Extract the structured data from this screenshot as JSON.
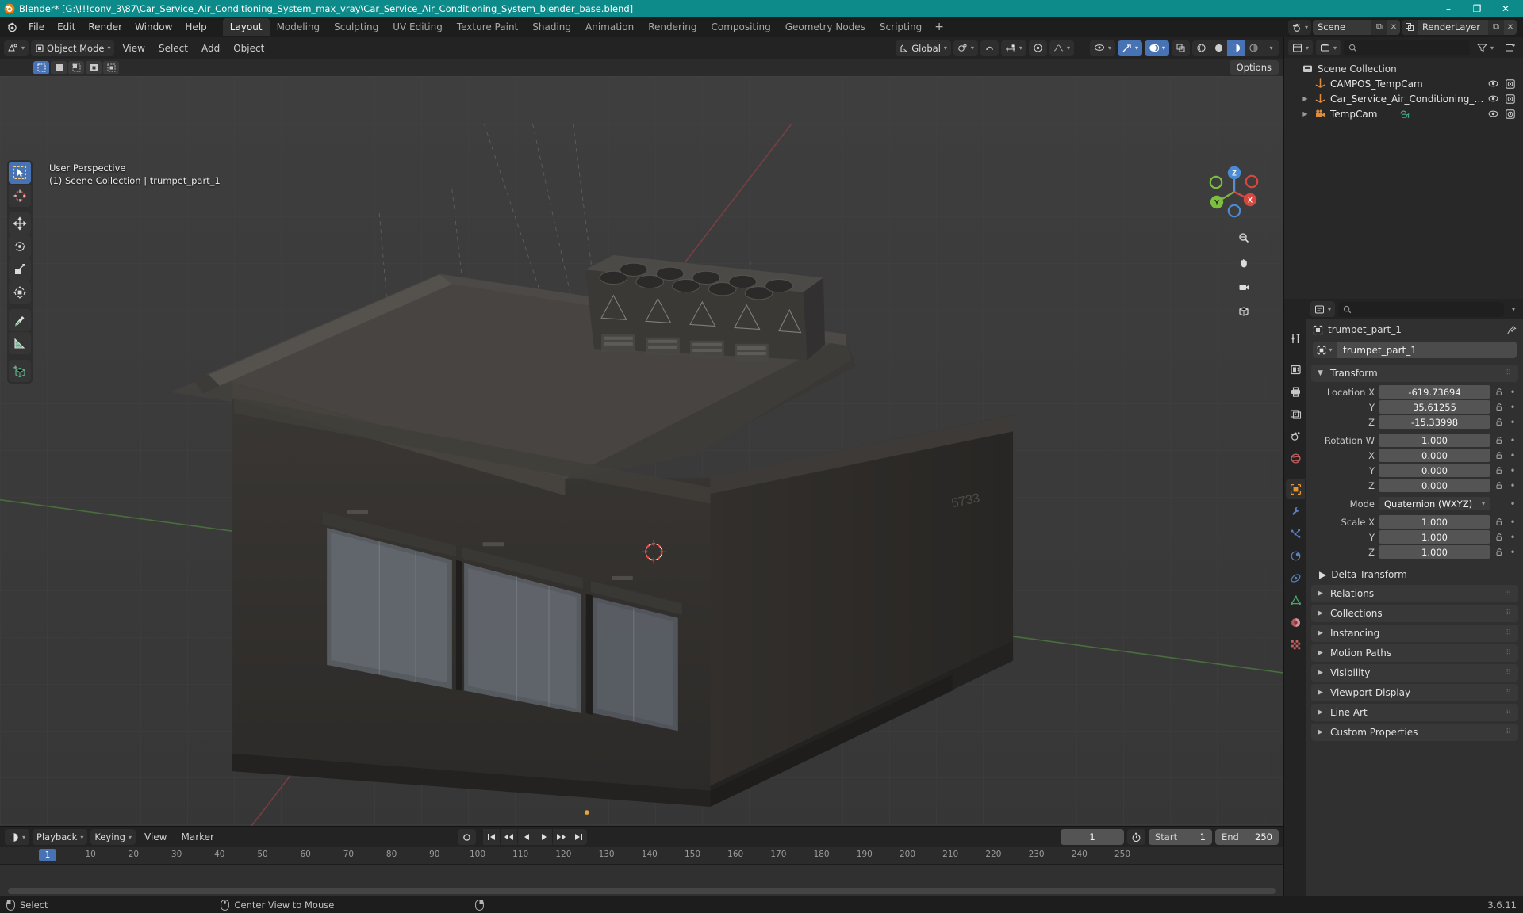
{
  "titlebar": {
    "text": "Blender* [G:\\!!!conv_3\\87\\Car_Service_Air_Conditioning_System_max_vray\\Car_Service_Air_Conditioning_System_blender_base.blend]",
    "minimize": "–",
    "maximize": "❐",
    "close": "✕",
    "accent": "#0d8a8a"
  },
  "topbar": {
    "menus": [
      "File",
      "Edit",
      "Render",
      "Window",
      "Help"
    ],
    "workspaces": [
      {
        "label": "Layout",
        "active": true
      },
      {
        "label": "Modeling",
        "active": false
      },
      {
        "label": "Sculpting",
        "active": false
      },
      {
        "label": "UV Editing",
        "active": false
      },
      {
        "label": "Texture Paint",
        "active": false
      },
      {
        "label": "Shading",
        "active": false
      },
      {
        "label": "Animation",
        "active": false
      },
      {
        "label": "Rendering",
        "active": false
      },
      {
        "label": "Compositing",
        "active": false
      },
      {
        "label": "Geometry Nodes",
        "active": false
      },
      {
        "label": "Scripting",
        "active": false
      }
    ],
    "add_workspace": "+",
    "scene_name": "Scene",
    "viewlayer_name": "RenderLayer"
  },
  "view3d_header": {
    "mode": "Object Mode",
    "menus": [
      "View",
      "Select",
      "Add",
      "Object"
    ],
    "transform_orientation": "Global",
    "options_label": "Options"
  },
  "viewport": {
    "perspective": "User Perspective",
    "scene_info": "(1) Scene Collection | trumpet_part_1",
    "gizmo_axes": [
      "X",
      "Y",
      "Z"
    ],
    "tools": [
      "tweak-select-tool",
      "cursor-tool",
      "move-tool",
      "rotate-tool",
      "scale-tool",
      "transform-tool",
      "annotate-tool",
      "measure-tool",
      "add-cube-tool"
    ],
    "nav_buttons": [
      "zoom-nav",
      "pan-nav",
      "camera-nav",
      "ortho-persp-nav"
    ]
  },
  "outliner": {
    "search_placeholder": "",
    "rows": [
      {
        "name": "Scene Collection",
        "icon": "collection-icon",
        "indent": 0,
        "arrow": "",
        "color": "#d8d8d8",
        "eye": true,
        "cam": true,
        "has_toggles": false
      },
      {
        "name": "CAMPOS_TempCam",
        "icon": "empty-axes-icon",
        "indent": 1,
        "arrow": "",
        "color": "#e8e8e8",
        "eye": true,
        "cam": true,
        "has_toggles": true
      },
      {
        "name": "Car_Service_Air_Conditioning_System",
        "icon": "empty-axes-icon",
        "indent": 1,
        "arrow": "▶",
        "color": "#e8e8e8",
        "eye": true,
        "cam": true,
        "has_toggles": true
      },
      {
        "name": "TempCam",
        "icon": "camera-icon",
        "indent": 1,
        "arrow": "▶",
        "color": "#e8e8e8",
        "eye": true,
        "cam": true,
        "has_toggles": true,
        "extra_icon": "camera-data-icon"
      }
    ]
  },
  "properties": {
    "search_placeholder": "",
    "breadcrumb_object": "trumpet_part_1",
    "object_name": "trumpet_part_1",
    "tabs": [
      "tool-tab",
      "render-tab",
      "output-tab",
      "view-layer-tab",
      "scene-tab",
      "world-tab",
      "object-tab",
      "modifiers-tab",
      "particles-tab",
      "physics-tab",
      "constraints-tab",
      "data-tab",
      "material-tab",
      "texture-tab"
    ],
    "active_tab": "object-tab",
    "transform": {
      "title": "Transform",
      "rows": [
        {
          "label": "Location X",
          "value": "-619.73694"
        },
        {
          "label": "Y",
          "value": "35.61255"
        },
        {
          "label": "Z",
          "value": "-15.33998"
        },
        {
          "label": "Rotation W",
          "value": "1.000"
        },
        {
          "label": "X",
          "value": "0.000"
        },
        {
          "label": "Y",
          "value": "0.000"
        },
        {
          "label": "Z",
          "value": "0.000"
        }
      ],
      "mode_label": "Mode",
      "mode_value": "Quaternion (WXYZ)",
      "scale_rows": [
        {
          "label": "Scale X",
          "value": "1.000"
        },
        {
          "label": "Y",
          "value": "1.000"
        },
        {
          "label": "Z",
          "value": "1.000"
        }
      ],
      "delta_transform": "Delta Transform"
    },
    "panels": [
      "Relations",
      "Collections",
      "Instancing",
      "Motion Paths",
      "Visibility",
      "Viewport Display",
      "Line Art",
      "Custom Properties"
    ]
  },
  "timeline": {
    "editor_menus": [
      "Playback",
      "Keying",
      "View",
      "Marker"
    ],
    "current_frame": "1",
    "start_label": "Start",
    "start_value": "1",
    "end_label": "End",
    "end_value": "250",
    "ticks": [
      "10",
      "20",
      "30",
      "40",
      "50",
      "60",
      "70",
      "80",
      "90",
      "100",
      "110",
      "120",
      "130",
      "140",
      "150",
      "160",
      "170",
      "180",
      "190",
      "200",
      "210",
      "220",
      "230",
      "240",
      "250"
    ],
    "playhead_frame": "1"
  },
  "statusbar": {
    "left_action": "Select",
    "mid_action": "Center View to Mouse",
    "version": "3.6.11"
  }
}
